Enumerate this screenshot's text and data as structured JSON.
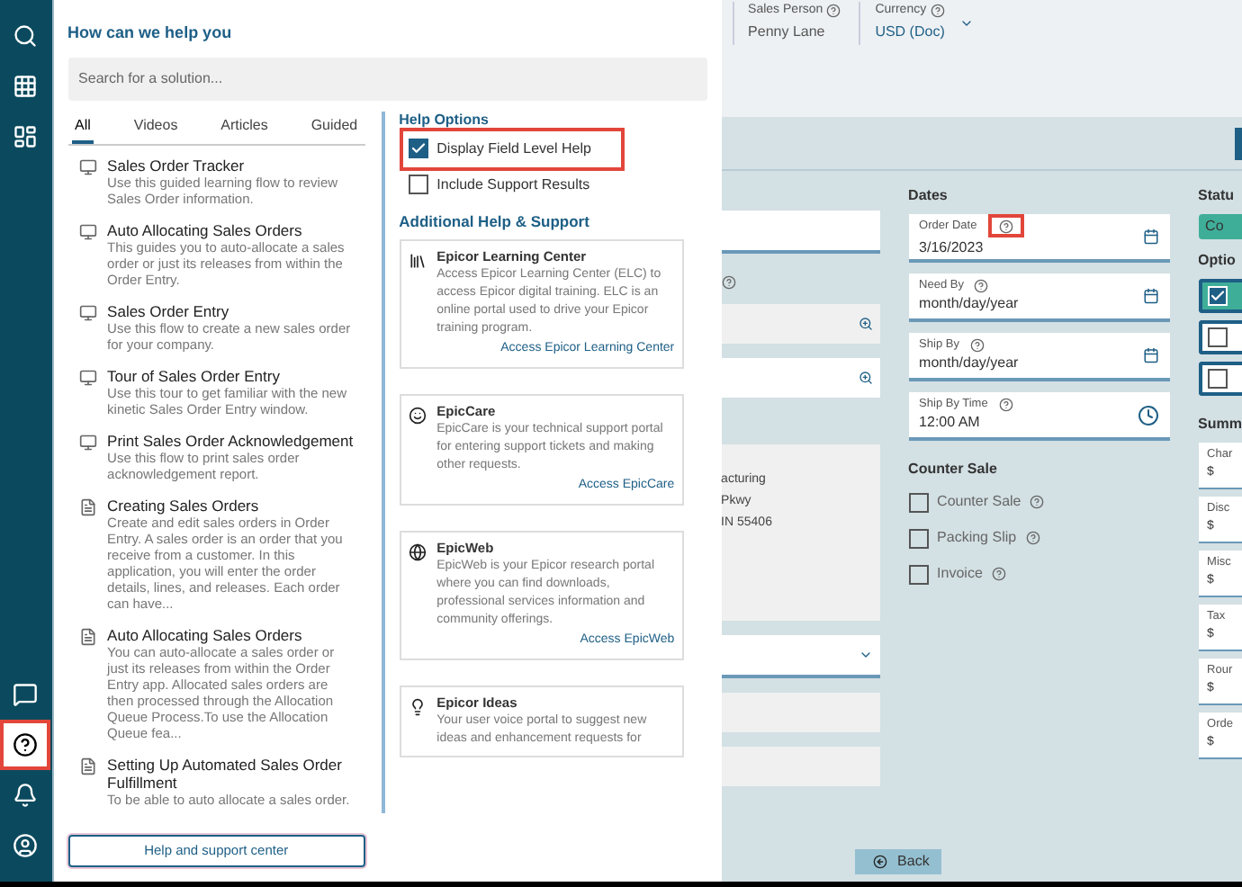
{
  "rail": {
    "top": [
      {
        "kind": "search",
        "selected": false
      },
      {
        "kind": "apps",
        "selected": false
      },
      {
        "kind": "dashboard",
        "selected": false
      }
    ],
    "bottom": [
      {
        "kind": "chat",
        "selected": false
      },
      {
        "kind": "help",
        "selected": true,
        "highlighted": true
      },
      {
        "kind": "bell",
        "selected": false
      },
      {
        "kind": "user",
        "selected": false
      }
    ]
  },
  "help_panel": {
    "title": "How can we help you",
    "search": {
      "placeholder": "Search for a solution..."
    },
    "tabs": [
      {
        "label": "All",
        "selected": true
      },
      {
        "label": "Videos",
        "selected": false
      },
      {
        "label": "Articles",
        "selected": false
      },
      {
        "label": "Guided",
        "selected": false
      }
    ],
    "articles": [
      {
        "kind": "guided",
        "title": "Sales Order Tracker",
        "description": "Use this guided learning flow to review Sales Order information."
      },
      {
        "kind": "guided",
        "title": "Auto Allocating Sales Orders",
        "description": "This guides you to auto-allocate a sales order or just its releases from within the Order Entry."
      },
      {
        "kind": "guided",
        "title": "Sales Order Entry",
        "description": "Use this flow to create a new sales order for your company."
      },
      {
        "kind": "guided",
        "title": "Tour of Sales Order Entry",
        "description": "Use this tour to get familiar with the new kinetic Sales Order Entry window."
      },
      {
        "kind": "guided",
        "title": "Print Sales Order Acknowledgement",
        "description": "Use this flow to print sales order acknowledgement report."
      },
      {
        "kind": "article",
        "title": "Creating Sales Orders",
        "description": "Create and edit sales orders in Order Entry. A sales order is an order that you receive from a customer. In this application, you will enter the order details, lines, and releases. Each order can have..."
      },
      {
        "kind": "article",
        "title": "Auto Allocating Sales Orders",
        "description": "You can auto-allocate a sales order or just its releases from within the Order Entry app. Allocated sales orders are then processed through the Allocation Queue Process.To use the Allocation Queue fea..."
      },
      {
        "kind": "article",
        "title": "Setting Up Automated Sales Order Fulfillment",
        "description": "To be able to auto allocate a sales order."
      }
    ],
    "support_button": "Help and support center",
    "options_heading": "Help Options",
    "options": [
      {
        "label": "Display Field Level Help",
        "checked": true,
        "highlighted": true
      },
      {
        "label": "Include Support Results",
        "checked": false,
        "highlighted": false
      }
    ],
    "additional_heading": "Additional Help & Support",
    "cards": [
      {
        "kind": "library",
        "title": "Epicor Learning Center",
        "description": "Access Epicor Learning Center (ELC) to access Epicor digital training. ELC is an online portal used to drive your Epicor training program.",
        "link": "Access Epicor Learning Center"
      },
      {
        "kind": "face",
        "title": "EpicCare",
        "description": "EpicCare is your technical support portal for entering support tickets and making other requests.",
        "link": "Access EpicCare"
      },
      {
        "kind": "globe",
        "title": "EpicWeb",
        "description": "EpicWeb is your Epicor research portal where you can find downloads, professional services information and community offerings.",
        "link": "Access EpicWeb"
      },
      {
        "kind": "bulb",
        "title": "Epicor Ideas",
        "description": "Your user voice portal to suggest new ideas and enhancement requests for"
      }
    ]
  },
  "header": {
    "fields": [
      {
        "label": "Sales Person",
        "value": "Penny Lane",
        "kind": "text"
      },
      {
        "label": "Currency",
        "value": "USD (Doc)",
        "kind": "dropdown"
      }
    ]
  },
  "left_column": {
    "address_lines": [
      "acturing",
      "Pkwy",
      "IN 55406"
    ]
  },
  "dates": {
    "heading": "Dates",
    "fields": [
      {
        "label": "Order Date",
        "value": "3/16/2023",
        "kind": "date",
        "highlighted": true
      },
      {
        "label": "Need By",
        "value": "month/day/year",
        "kind": "date",
        "highlighted": false
      },
      {
        "label": "Ship By",
        "value": "month/day/year",
        "kind": "date",
        "highlighted": false
      },
      {
        "label": "Ship By Time",
        "value": "12:00 AM",
        "kind": "time",
        "highlighted": false
      }
    ]
  },
  "counter_sale": {
    "heading": "Counter Sale",
    "options": [
      {
        "label": "Counter Sale",
        "checked": false
      },
      {
        "label": "Packing Slip",
        "checked": false
      },
      {
        "label": "Invoice",
        "checked": false
      }
    ]
  },
  "right_column": {
    "status_heading": "Statu",
    "status_badge": "Co",
    "options_heading": "Optio",
    "options": [
      {
        "checked": true
      },
      {
        "checked": false
      },
      {
        "checked": false
      }
    ],
    "summary_heading": "Summ",
    "summary": [
      {
        "label": "Char",
        "value": "$"
      },
      {
        "label": "Disc",
        "value": "$"
      },
      {
        "label": "Misc",
        "value": "$"
      },
      {
        "label": "Tax",
        "value": "$"
      },
      {
        "label": "Rour",
        "value": "$"
      },
      {
        "label": "Orde",
        "value": "$"
      }
    ]
  },
  "back_button": "Back"
}
